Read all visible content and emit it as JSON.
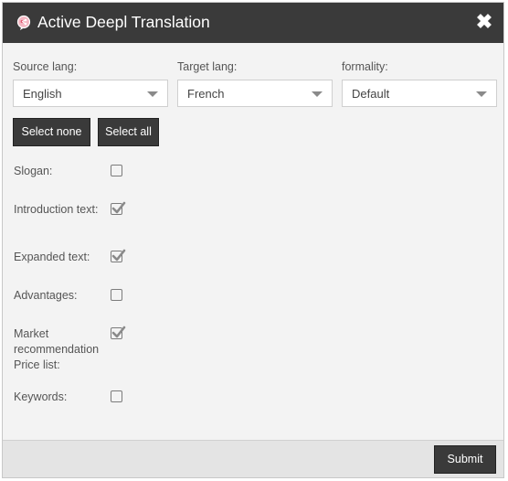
{
  "dialog": {
    "title": "Active Deepl Translation",
    "close_glyph": "✖"
  },
  "fields": {
    "source": {
      "label": "Source lang:",
      "value": "English"
    },
    "target": {
      "label": "Target lang:",
      "value": "French"
    },
    "formality": {
      "label": "formality:",
      "value": "Default"
    }
  },
  "buttons": {
    "select_none": "Select none",
    "select_all": "Select all",
    "submit": "Submit"
  },
  "options": [
    {
      "label": "Slogan:",
      "checked": false
    },
    {
      "label": "Introduction text:",
      "checked": true
    },
    {
      "label": "Expanded text:",
      "checked": true
    },
    {
      "label": "Advantages:",
      "checked": false
    },
    {
      "label": "Market recommendation Price list:",
      "checked": true
    },
    {
      "label": "Keywords:",
      "checked": false
    }
  ],
  "colors": {
    "titlebar": "#3a3a3a",
    "dialog_bg": "#f3f3f3",
    "button_bg": "#3a3a3a",
    "checkmark": "#8a8a8a"
  },
  "icons": {
    "title": "deepl-logo-icon",
    "close": "close-icon",
    "dropdown": "chevron-down-icon",
    "check": "checkmark-icon"
  }
}
